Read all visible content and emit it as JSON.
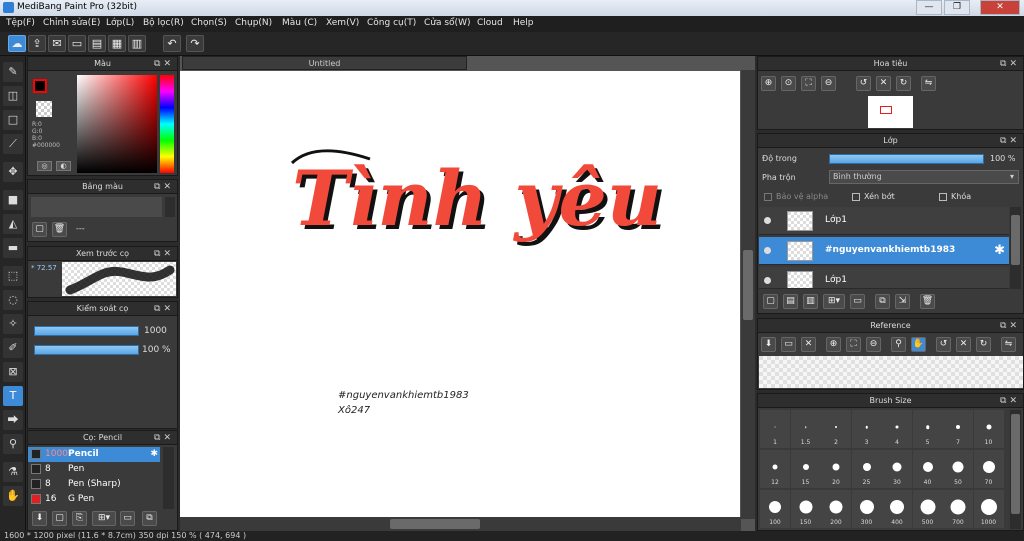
{
  "app": {
    "title": "MediBang Paint Pro (32bit)"
  },
  "window_buttons": [
    "—",
    "❐",
    "✕"
  ],
  "menu": [
    "Tệp(F)",
    "Chỉnh sửa(E)",
    "Lớp(L)",
    "Bộ lọc(R)",
    "Chọn(S)",
    "Chụp(N)",
    "Màu (C)",
    "Xem(V)",
    "Công cụ(T)",
    "Cửa sổ(W)",
    "Cloud",
    "Help"
  ],
  "color_panel": {
    "title": "Màu",
    "readout": [
      "R:0",
      "G:0",
      "B:0",
      "#000000"
    ],
    "primary_color": "#ff0000"
  },
  "palette_panel": {
    "title": "Bảng màu",
    "dash": "---"
  },
  "brush_preview": {
    "title": "Xem trước cọ",
    "zoom": "* 72.57"
  },
  "control_panel": {
    "title": "Kiểm soát cọ",
    "size": "1000",
    "opacity": "100 %",
    "size_fraction": 1.0,
    "opacity_fraction": 1.0
  },
  "brush_panel": {
    "title": "Cọ: Pencil",
    "items": [
      {
        "size": "1000",
        "name": "Pencil",
        "color": "#222222",
        "selected": true
      },
      {
        "size": "8",
        "name": "Pen",
        "color": "#222222",
        "selected": false
      },
      {
        "size": "8",
        "name": "Pen (Sharp)",
        "color": "#222222",
        "selected": false
      },
      {
        "size": "16",
        "name": "G Pen",
        "color": "#e02020",
        "selected": false
      }
    ]
  },
  "canvas": {
    "tab": "Untitled",
    "main_text": "Tình yêu",
    "sig_line1": "#nguyenvankhiemtb1983",
    "sig_line2": "Xô247"
  },
  "navigator_panel": {
    "title": "Hoa tiêu"
  },
  "layer_panel": {
    "title": "Lớp",
    "opacity_label": "Độ trong",
    "opacity_value": "100 %",
    "opacity_fraction": 1.0,
    "blend_label": "Pha trộn",
    "blend_value": "Bình thường",
    "protect_alpha": "Bảo vệ alpha",
    "clipping": "Xén bớt",
    "lock": "Khóa",
    "layers": [
      {
        "name": "Lớp1",
        "selected": false
      },
      {
        "name": "#nguyenvankhiemtb1983",
        "selected": true
      },
      {
        "name": "Lớp1",
        "selected": false
      }
    ]
  },
  "reference_panel": {
    "title": "Reference"
  },
  "brush_size_panel": {
    "title": "Brush Size",
    "sizes": [
      "1",
      "1.5",
      "2",
      "3",
      "4",
      "5",
      "7",
      "10",
      "12",
      "15",
      "20",
      "25",
      "30",
      "40",
      "50",
      "70",
      "100",
      "150",
      "200",
      "300",
      "400",
      "500",
      "700",
      "1000"
    ]
  },
  "statusbar": {
    "text": "1600 * 1200 pixel   (11.6 * 8.7cm)   350 dpi   150 %   ( 474, 694 )"
  }
}
